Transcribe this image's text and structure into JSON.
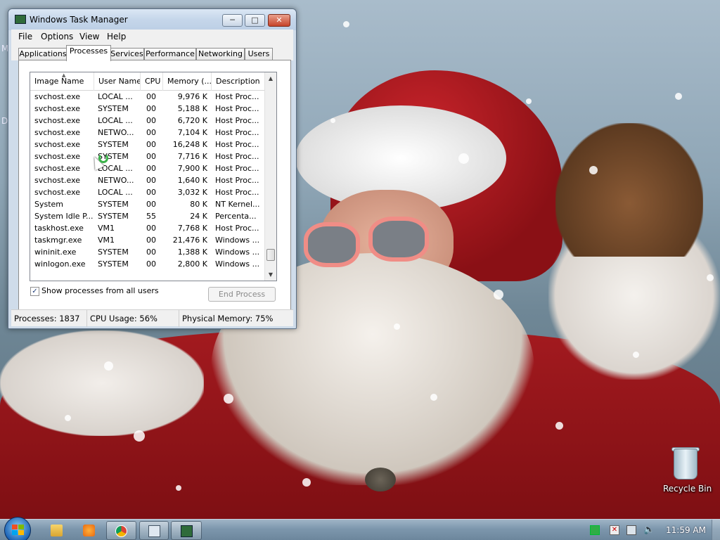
{
  "window": {
    "title": "Windows Task Manager",
    "menu": [
      "File",
      "Options",
      "View",
      "Help"
    ],
    "tabs": [
      "Applications",
      "Processes",
      "Services",
      "Performance",
      "Networking",
      "Users"
    ],
    "active_tab": "Processes"
  },
  "processes": {
    "columns": [
      "Image Name",
      "User Name",
      "CPU",
      "Memory (...",
      "Description"
    ],
    "rows": [
      {
        "image": "svchost.exe",
        "user": "LOCAL ...",
        "cpu": "00",
        "mem": "9,976 K",
        "desc": "Host Proc..."
      },
      {
        "image": "svchost.exe",
        "user": "SYSTEM",
        "cpu": "00",
        "mem": "5,188 K",
        "desc": "Host Proc..."
      },
      {
        "image": "svchost.exe",
        "user": "LOCAL ...",
        "cpu": "00",
        "mem": "6,720 K",
        "desc": "Host Proc..."
      },
      {
        "image": "svchost.exe",
        "user": "NETWO...",
        "cpu": "00",
        "mem": "7,104 K",
        "desc": "Host Proc..."
      },
      {
        "image": "svchost.exe",
        "user": "SYSTEM",
        "cpu": "00",
        "mem": "16,248 K",
        "desc": "Host Proc..."
      },
      {
        "image": "svchost.exe",
        "user": "SYSTEM",
        "cpu": "00",
        "mem": "7,716 K",
        "desc": "Host Proc..."
      },
      {
        "image": "svchost.exe",
        "user": "LOCAL ...",
        "cpu": "00",
        "mem": "7,900 K",
        "desc": "Host Proc..."
      },
      {
        "image": "svchost.exe",
        "user": "NETWO...",
        "cpu": "00",
        "mem": "1,640 K",
        "desc": "Host Proc..."
      },
      {
        "image": "svchost.exe",
        "user": "LOCAL ...",
        "cpu": "00",
        "mem": "3,032 K",
        "desc": "Host Proc..."
      },
      {
        "image": "System",
        "user": "SYSTEM",
        "cpu": "00",
        "mem": "80 K",
        "desc": "NT Kernel..."
      },
      {
        "image": "System Idle P...",
        "user": "SYSTEM",
        "cpu": "55",
        "mem": "24 K",
        "desc": "Percenta..."
      },
      {
        "image": "taskhost.exe",
        "user": "VM1",
        "cpu": "00",
        "mem": "7,768 K",
        "desc": "Host Proc..."
      },
      {
        "image": "taskmgr.exe",
        "user": "VM1",
        "cpu": "00",
        "mem": "21,476 K",
        "desc": "Windows ..."
      },
      {
        "image": "wininit.exe",
        "user": "SYSTEM",
        "cpu": "00",
        "mem": "1,388 K",
        "desc": "Windows ..."
      },
      {
        "image": "winlogon.exe",
        "user": "SYSTEM",
        "cpu": "00",
        "mem": "2,800 K",
        "desc": "Windows ..."
      }
    ],
    "show_all_label": "Show processes from all users",
    "show_all_checked": true,
    "end_process_label": "End Process"
  },
  "status": {
    "processes": "Processes: 1837",
    "cpu": "CPU Usage: 56%",
    "memory": "Physical Memory: 75%"
  },
  "desktop": {
    "recycle_bin_label": "Recycle Bin"
  },
  "taskbar": {
    "clock": "11:59 AM",
    "pinned": [
      "explorer-icon",
      "media-player-icon",
      "chrome-icon",
      "task-switch-icon",
      "task-manager-icon"
    ],
    "tray": [
      "network-icon",
      "action-center-icon",
      "display-icon",
      "volume-icon"
    ]
  },
  "colors": {
    "window_frame": "#cfdcea",
    "close_button": "#c6432a",
    "taskbar": "#7d97ad",
    "santa_red": "#b3191f"
  }
}
